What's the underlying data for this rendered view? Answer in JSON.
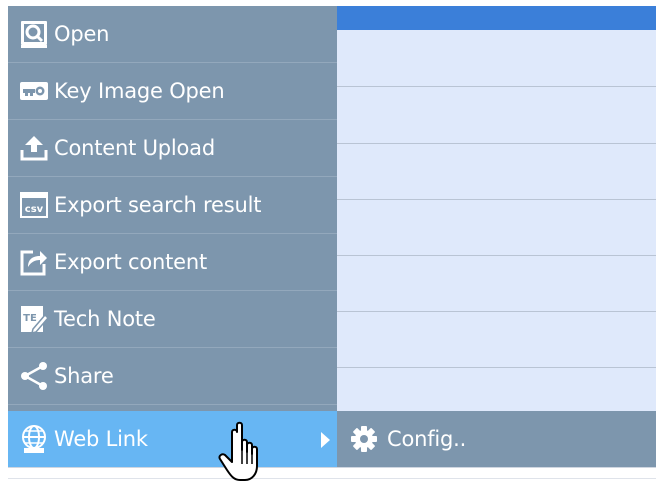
{
  "menu": {
    "items": [
      {
        "label": "Open",
        "icon": "magnifier-open-icon"
      },
      {
        "label": "Key Image Open",
        "icon": "key-icon"
      },
      {
        "label": "Content Upload",
        "icon": "upload-icon"
      },
      {
        "label": "Export search result",
        "icon": "csv-icon"
      },
      {
        "label": "Export content",
        "icon": "export-icon"
      },
      {
        "label": "Tech Note",
        "icon": "tech-note-icon"
      },
      {
        "label": "Share",
        "icon": "share-icon"
      },
      {
        "label": "Web Link",
        "icon": "globe-icon",
        "active": true,
        "has_submenu": true
      }
    ]
  },
  "submenu": {
    "items": [
      {
        "label": "Config..",
        "icon": "gear-icon"
      }
    ]
  },
  "colors": {
    "menu_bg": "#7d96ad",
    "menu_active": "#67b6f3",
    "list_bg": "#dfe9fb",
    "list_header": "#3b7fd9",
    "text": "#ffffff"
  }
}
